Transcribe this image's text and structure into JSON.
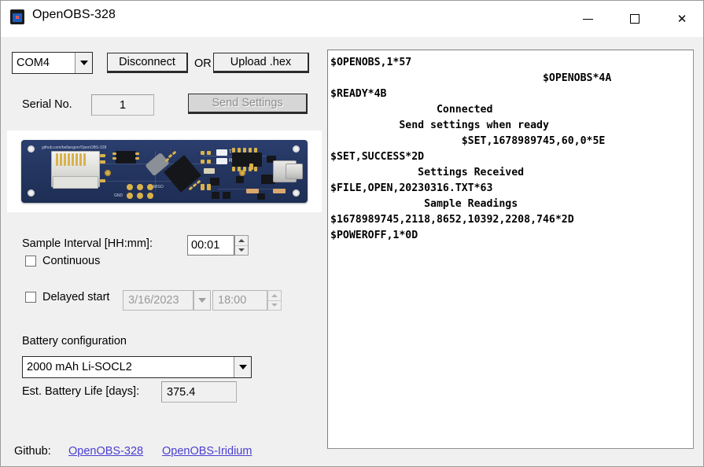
{
  "window": {
    "title": "OpenOBS-328",
    "icon": "app-icon",
    "minimize_label": "─",
    "maximize_label": "□",
    "close_label": "✕"
  },
  "connection": {
    "port_value": "COM4",
    "port_options": [
      "COM4"
    ],
    "disconnect_label": "Disconnect",
    "or_label": "OR",
    "upload_label": "Upload .hex",
    "serial_label": "Serial No.",
    "serial_value": "1",
    "send_settings_label": "Send Settings",
    "send_settings_enabled": false
  },
  "board": {
    "silkscreen": "github.com/bellangerr/OpenOBS-328",
    "labels": {
      "tx": "TX",
      "rx": "RX",
      "miso": "MISO",
      "gnd": "GND"
    }
  },
  "sampling": {
    "interval_label": "Sample Interval [HH:mm]:",
    "interval_value": "00:01",
    "continuous_label": "Continuous",
    "continuous_checked": false,
    "delayed_start_label": "Delayed start",
    "delayed_start_checked": false,
    "delayed_date": "3/16/2023",
    "delayed_time": "18:00"
  },
  "battery": {
    "section_label": "Battery configuration",
    "selected": "2000 mAh Li-SOCL2",
    "options": [
      "2000 mAh Li-SOCL2"
    ],
    "life_label": "Est. Battery Life [days]:",
    "life_value": "375.4"
  },
  "footer": {
    "github_label": "Github:",
    "link1": "OpenOBS-328",
    "link2": "OpenOBS-Iridium",
    "link_color": "#4b3ecf"
  },
  "terminal": {
    "text": "$OPENOBS,1*57\n                                  $OPENOBS*4A\n$READY*4B\n                 Connected\n           Send settings when ready\n                     $SET,1678989745,60,0*5E\n$SET,SUCCESS*2D\n              Settings Received\n$FILE,OPEN,20230316.TXT*63\n               Sample Readings\n$1678989745,2118,8652,10392,2208,746*2D\n$POWEROFF,1*0D",
    "lines": [
      "$OPENOBS,1*57",
      "$OPENOBS*4A",
      "$READY*4B",
      "Connected",
      "Send settings when ready",
      "$SET,1678989745,60,0*5E",
      "$SET,SUCCESS*2D",
      "Settings Received",
      "$FILE,OPEN,20230316.TXT*63",
      "Sample Readings",
      "$1678989745,2118,8652,10392,2208,746*2D",
      "$POWEROFF,1*0D"
    ]
  }
}
